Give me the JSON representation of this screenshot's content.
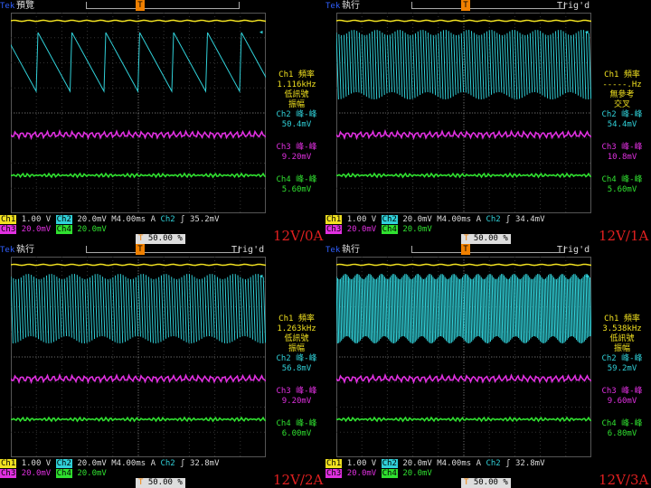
{
  "colors": {
    "ch1": "#f0e020",
    "ch2": "#30d0d8",
    "ch3": "#e030e0",
    "ch4": "#30e030",
    "label": "#e02020"
  },
  "panels": [
    {
      "tek": "Tek",
      "state": "預覽",
      "trig": "",
      "side": {
        "ch1_a": "Ch1 頻率",
        "ch1_b": "1.116kHz",
        "ch1_c": "低訊號",
        "ch1_d": "振幅",
        "ch2_a": "Ch2 峰-峰",
        "ch2_b": "50.4mV",
        "ch3_a": "Ch3 峰-峰",
        "ch3_b": "9.20mV",
        "ch4_a": "Ch4 峰-峰",
        "ch4_b": "5.60mV"
      },
      "bottom": {
        "ch1": "Ch1",
        "ch1_v": "1.00 V",
        "ch2": "Ch2",
        "ch2_v": "20.0mV",
        "time": "M4.00ms",
        "a": "A",
        "trig_ch": "Ch2",
        "trig_v": "35.2mV",
        "ch3": "Ch3",
        "ch3_v": "20.0mV",
        "ch4": "Ch4",
        "ch4_v": "20.0mV"
      },
      "pct": "50.00 %",
      "label": "12V/0A",
      "waveform": "sawtooth"
    },
    {
      "tek": "Tek",
      "state": "執行",
      "trig": "Trig'd",
      "side": {
        "ch1_a": "Ch1 頻率",
        "ch1_b": "-----.Hz",
        "ch1_c": "無參考",
        "ch1_d": "交叉",
        "ch2_a": "Ch2 峰-峰",
        "ch2_b": "54.4mV",
        "ch3_a": "Ch3 峰-峰",
        "ch3_b": "10.8mV",
        "ch4_a": "Ch4 峰-峰",
        "ch4_b": "5.60mV"
      },
      "bottom": {
        "ch1": "Ch1",
        "ch1_v": "1.00 V",
        "ch2": "Ch2",
        "ch2_v": "20.0mV",
        "time": "M4.00ms",
        "a": "A",
        "trig_ch": "Ch2",
        "trig_v": "34.4mV",
        "ch3": "Ch3",
        "ch3_v": "20.0mV",
        "ch4": "Ch4",
        "ch4_v": "20.0mV"
      },
      "pct": "50.00 %",
      "label": "12V/1A",
      "waveform": "dense"
    },
    {
      "tek": "Tek",
      "state": "執行",
      "trig": "Trig'd",
      "side": {
        "ch1_a": "Ch1 頻率",
        "ch1_b": "1.263kHz",
        "ch1_c": "低訊號",
        "ch1_d": "振幅",
        "ch2_a": "Ch2 峰-峰",
        "ch2_b": "56.8mV",
        "ch3_a": "Ch3 峰-峰",
        "ch3_b": "9.20mV",
        "ch4_a": "Ch4 峰-峰",
        "ch4_b": "6.00mV"
      },
      "bottom": {
        "ch1": "Ch1",
        "ch1_v": "1.00 V",
        "ch2": "Ch2",
        "ch2_v": "20.0mV",
        "time": "M4.00ms",
        "a": "A",
        "trig_ch": "Ch2",
        "trig_v": "32.8mV",
        "ch3": "Ch3",
        "ch3_v": "20.0mV",
        "ch4": "Ch4",
        "ch4_v": "20.0mV"
      },
      "pct": "50.00 %",
      "label": "12V/2A",
      "waveform": "dense"
    },
    {
      "tek": "Tek",
      "state": "執行",
      "trig": "Trig'd",
      "side": {
        "ch1_a": "Ch1 頻率",
        "ch1_b": "3.538kHz",
        "ch1_c": "低訊號",
        "ch1_d": "振幅",
        "ch2_a": "Ch2 峰-峰",
        "ch2_b": "59.2mV",
        "ch3_a": "Ch3 峰-峰",
        "ch3_b": "9.60mV",
        "ch4_a": "Ch4 峰-峰",
        "ch4_b": "6.80mV"
      },
      "bottom": {
        "ch1": "Ch1",
        "ch1_v": "1.00 V",
        "ch2": "Ch2",
        "ch2_v": "20.0mV",
        "time": "M4.00ms",
        "a": "A",
        "trig_ch": "Ch2",
        "trig_v": "32.8mV",
        "ch3": "Ch3",
        "ch3_v": "20.0mV",
        "ch4": "Ch4",
        "ch4_v": "20.0mV"
      },
      "pct": "50.00 %",
      "label": "12V/3A",
      "waveform": "denser"
    }
  ]
}
